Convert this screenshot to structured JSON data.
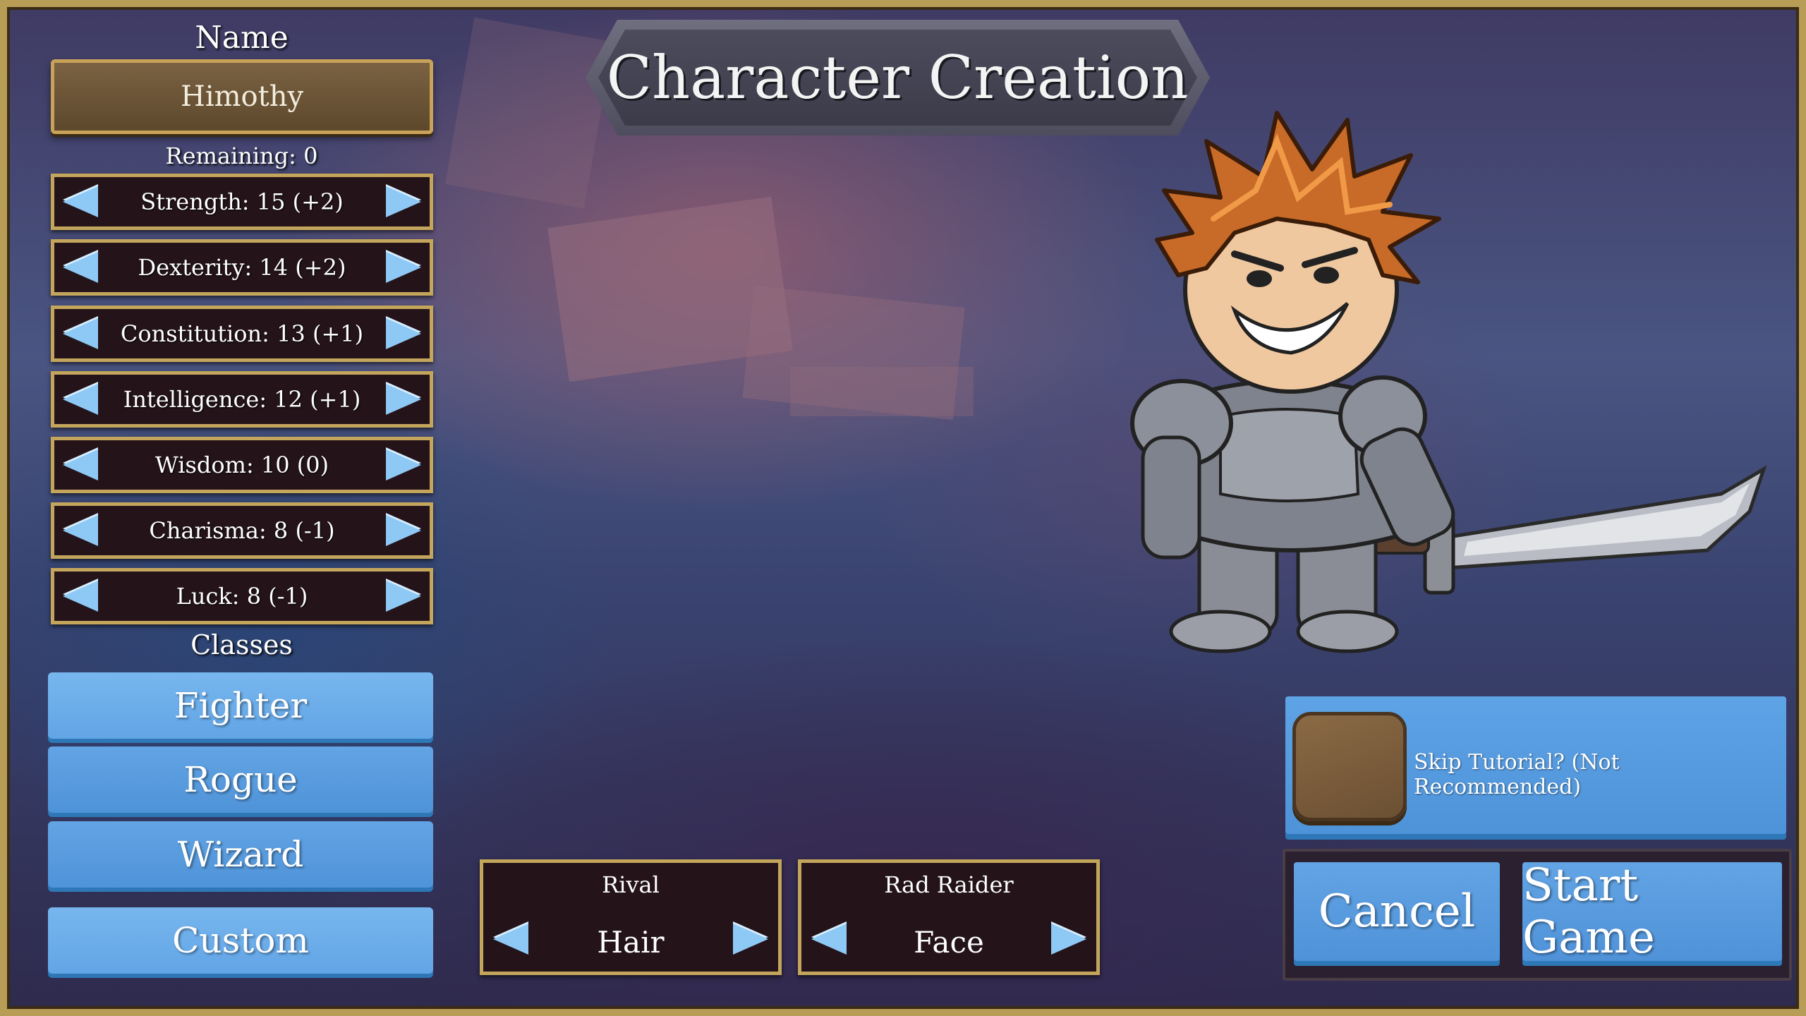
{
  "name": {
    "label": "Name",
    "value": "Himothy"
  },
  "remaining": "Remaining: 0",
  "stats": [
    {
      "text": "Strength: 15 (+2)"
    },
    {
      "text": "Dexterity: 14 (+2)"
    },
    {
      "text": "Constitution: 13 (+1)"
    },
    {
      "text": "Intelligence: 12 (+1)"
    },
    {
      "text": "Wisdom: 10 (0)"
    },
    {
      "text": "Charisma: 8 (-1)"
    },
    {
      "text": "Luck: 8 (-1)"
    }
  ],
  "classes": {
    "label": "Classes",
    "items": [
      "Fighter",
      "Rogue",
      "Wizard",
      "Custom"
    ]
  },
  "title": "Character Creation",
  "appearance": [
    {
      "name": "Rival",
      "part": "Hair"
    },
    {
      "name": "Rad Raider",
      "part": "Face"
    }
  ],
  "skip_tutorial": {
    "label": "Skip Tutorial? (Not Recommended)",
    "checked": false
  },
  "buttons": {
    "cancel": "Cancel",
    "start": "Start Game"
  },
  "icons": {
    "prev": "left-arrow-icon",
    "next": "right-arrow-icon"
  },
  "colors": {
    "button_blue": "#5ea3e6",
    "frame_gold": "#c4a55c",
    "panel_dark": "#24141a",
    "arrow_blue": "#8ec8f4"
  }
}
